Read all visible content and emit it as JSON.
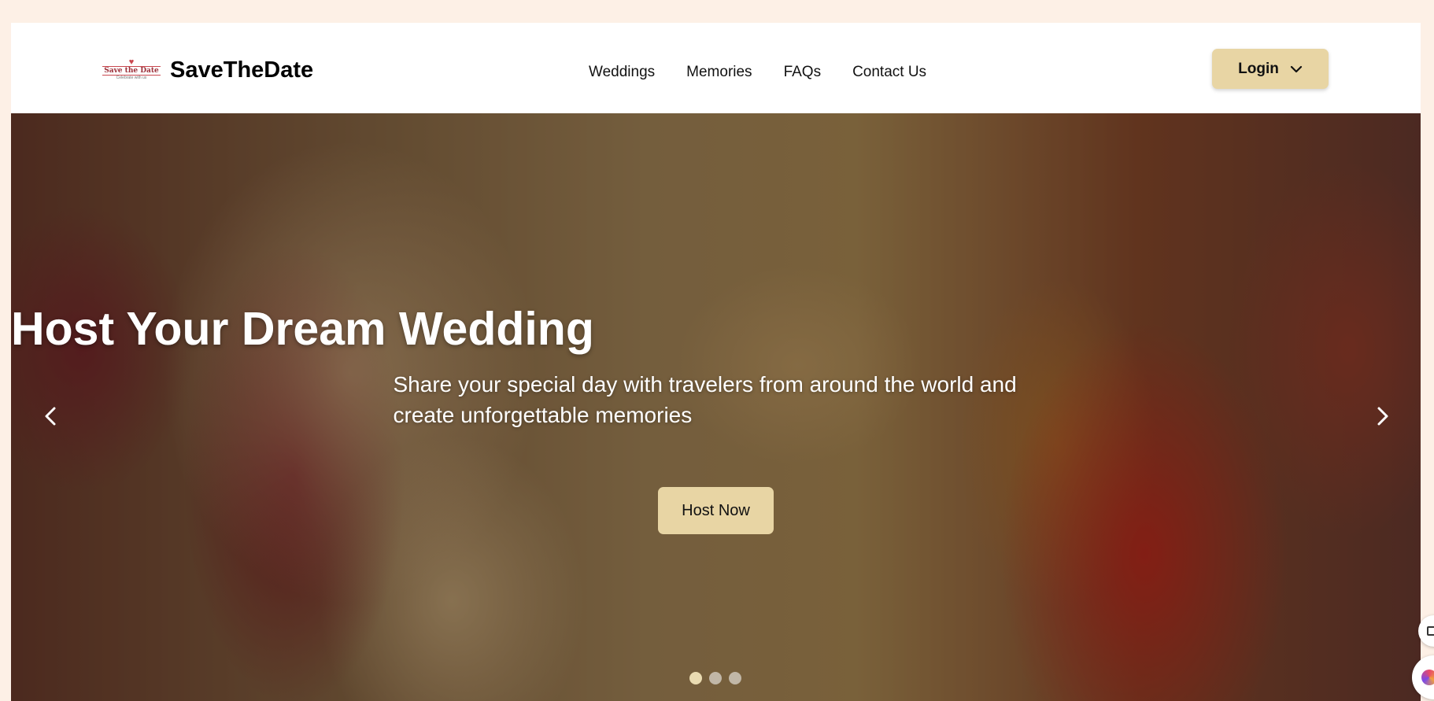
{
  "brand": {
    "logo_title": "Save the Date",
    "logo_subtitle": "Celebrate with us",
    "name": "SaveTheDate"
  },
  "nav": {
    "links": [
      "Weddings",
      "Memories",
      "FAQs",
      "Contact Us"
    ],
    "login_label": "Login"
  },
  "hero": {
    "title": "Host Your Dream Wedding",
    "subtitle": "Share your special day with travelers from around the world and create unforgettable memories",
    "cta_label": "Host Now",
    "slides_total": 3,
    "active_slide": 1
  },
  "icons": {
    "prev": "chevron-left-icon",
    "next": "chevron-right-icon",
    "login_caret": "chevron-down-icon"
  },
  "colors": {
    "page_background": "#fdf0e6",
    "accent_button": "#e8d5a4",
    "logo_red": "#9c2f39"
  }
}
